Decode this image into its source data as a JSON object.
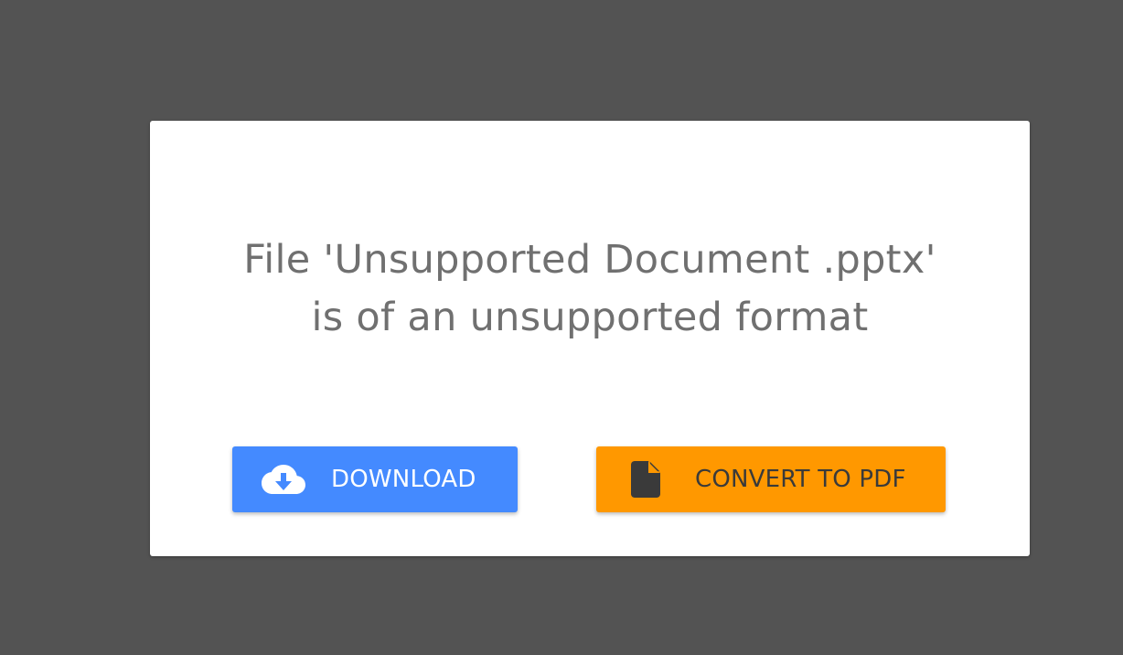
{
  "dialog": {
    "message_line1": "File 'Unsupported Document .pptx'",
    "message_line2": "is of an unsupported format"
  },
  "buttons": {
    "download": {
      "label": "DOWNLOAD",
      "icon": "cloud-download-icon",
      "color": "#448aff"
    },
    "convert": {
      "label": "CONVERT TO PDF",
      "icon": "file-icon",
      "color": "#ff9800"
    }
  },
  "colors": {
    "background": "#535353",
    "dialog": "#ffffff",
    "message_text": "#707070"
  }
}
